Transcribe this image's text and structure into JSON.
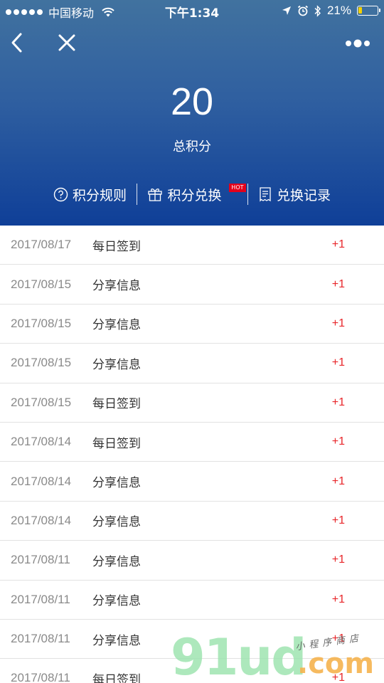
{
  "status_bar": {
    "carrier": "中国移动",
    "time": "下午1:34",
    "battery_percent": "21%",
    "battery_level": 0.21
  },
  "nav": {
    "back_icon": "chevron-left-icon",
    "close_icon": "close-icon",
    "more_icon": "more-dots-icon"
  },
  "summary": {
    "points": "20",
    "label": "总积分"
  },
  "actions": {
    "rules": "积分规则",
    "exchange": "积分兑换",
    "exchange_badge": "HOT",
    "records": "兑换记录"
  },
  "records": [
    {
      "date": "2017/08/17",
      "type": "每日签到",
      "delta": "+1"
    },
    {
      "date": "2017/08/15",
      "type": "分享信息",
      "delta": "+1"
    },
    {
      "date": "2017/08/15",
      "type": "分享信息",
      "delta": "+1"
    },
    {
      "date": "2017/08/15",
      "type": "分享信息",
      "delta": "+1"
    },
    {
      "date": "2017/08/15",
      "type": "每日签到",
      "delta": "+1"
    },
    {
      "date": "2017/08/14",
      "type": "每日签到",
      "delta": "+1"
    },
    {
      "date": "2017/08/14",
      "type": "分享信息",
      "delta": "+1"
    },
    {
      "date": "2017/08/14",
      "type": "分享信息",
      "delta": "+1"
    },
    {
      "date": "2017/08/11",
      "type": "分享信息",
      "delta": "+1"
    },
    {
      "date": "2017/08/11",
      "type": "分享信息",
      "delta": "+1"
    },
    {
      "date": "2017/08/11",
      "type": "分享信息",
      "delta": "+1"
    },
    {
      "date": "2017/08/11",
      "type": "每日签到",
      "delta": "+1"
    }
  ],
  "watermark": {
    "brand": "91ud",
    "tld": ".com",
    "tagline": "小程序商店"
  },
  "colors": {
    "header_top": "#41729f",
    "header_bottom": "#0f3f98",
    "delta_red": "#e8262a",
    "badge_red": "#e3001b"
  }
}
